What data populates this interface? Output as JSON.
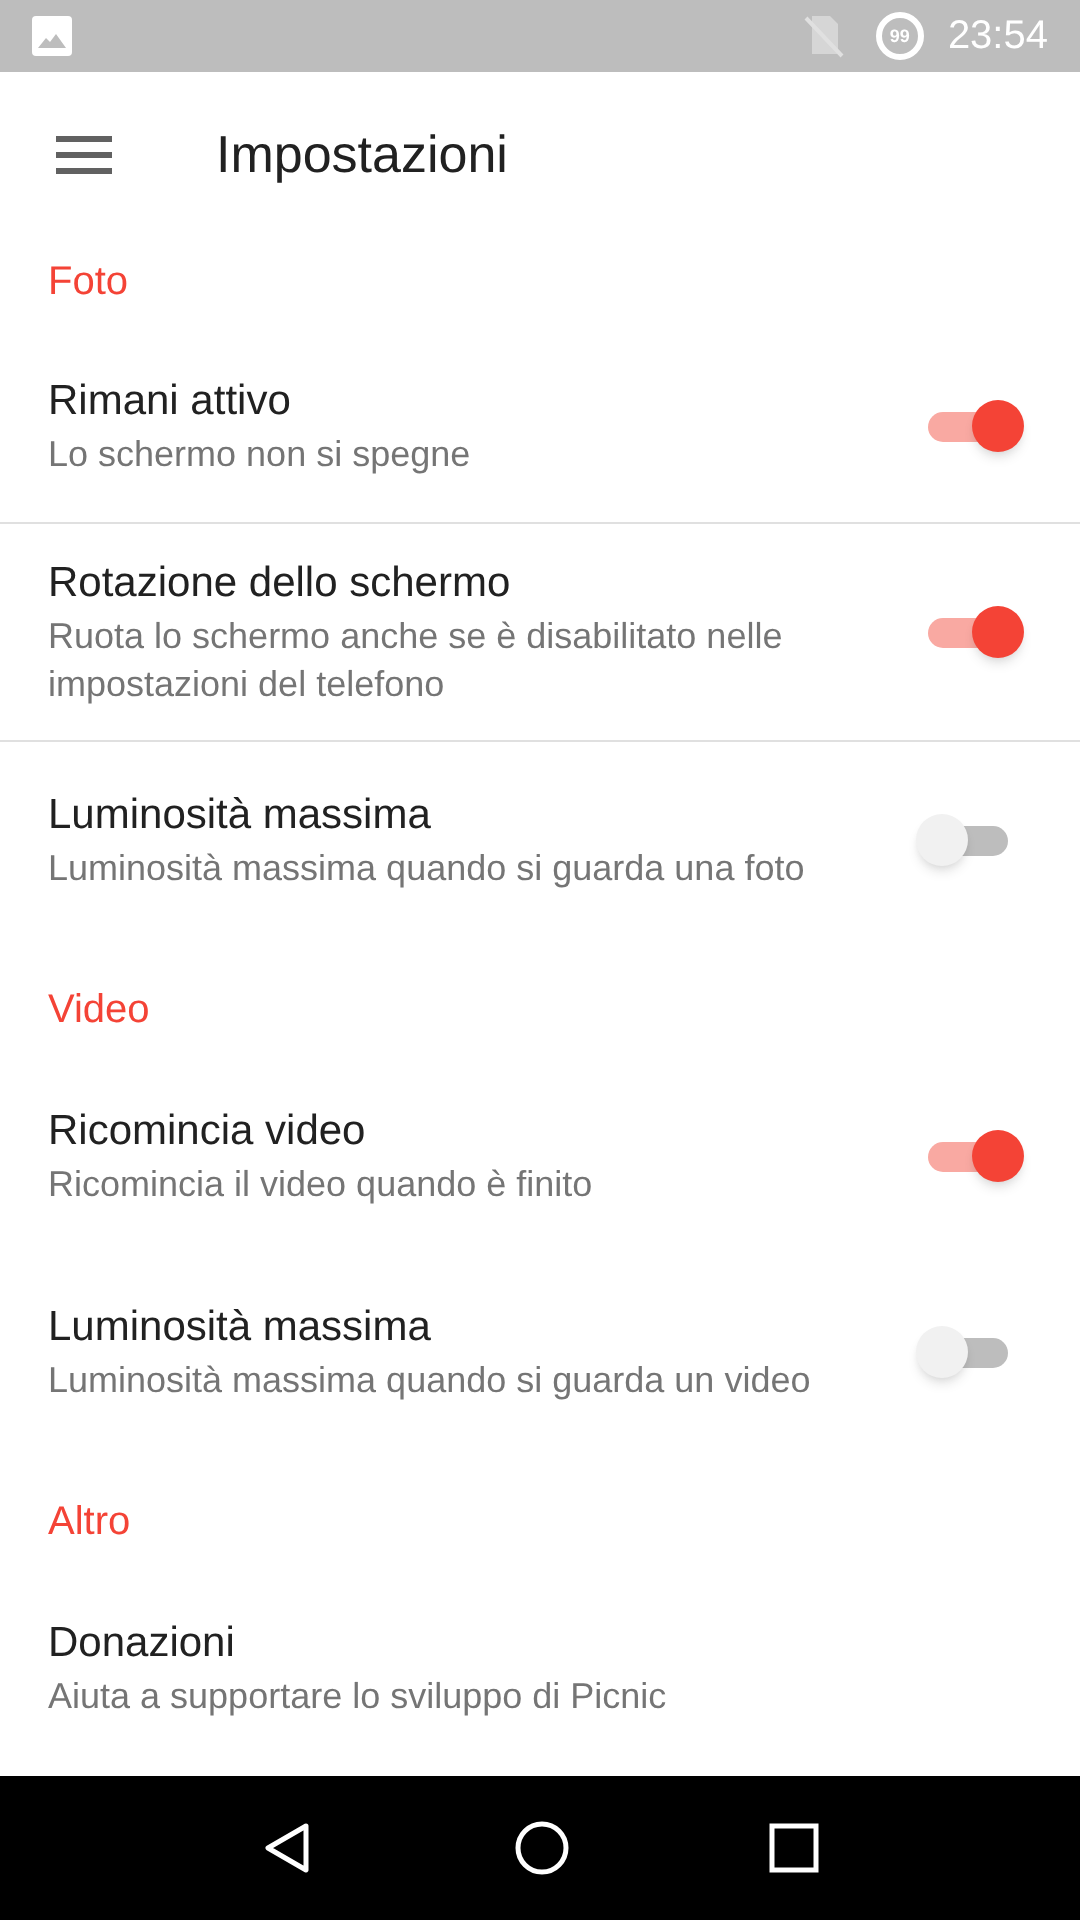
{
  "status_bar": {
    "battery": "99",
    "time": "23:54"
  },
  "app_bar": {
    "title": "Impostazioni"
  },
  "sections": [
    {
      "title": "Foto",
      "items": [
        {
          "kind": "switch",
          "title": "Rimani attivo",
          "summary": "Lo schermo non si spegne",
          "on": true,
          "divider_below": true
        },
        {
          "kind": "switch",
          "title": "Rotazione dello schermo",
          "summary": "Ruota lo schermo anche se è disabilitato nelle impostazioni del telefono",
          "on": true,
          "divider_below": true
        },
        {
          "kind": "switch",
          "title": "Luminosità massima",
          "summary": "Luminosità massima quando si guarda una foto",
          "on": false,
          "divider_below": false
        }
      ]
    },
    {
      "title": "Video",
      "items": [
        {
          "kind": "switch",
          "title": "Ricomincia video",
          "summary": "Ricomincia il video quando è finito",
          "on": true,
          "divider_below": false
        },
        {
          "kind": "switch",
          "title": "Luminosità massima",
          "summary": "Luminosità massima quando si guarda un video",
          "on": false,
          "divider_below": false
        }
      ]
    },
    {
      "title": "Altro",
      "items": [
        {
          "kind": "plain",
          "title": "Donazioni",
          "summary": "Aiuta a supportare lo sviluppo di Picnic",
          "divider_below": false
        }
      ]
    }
  ]
}
